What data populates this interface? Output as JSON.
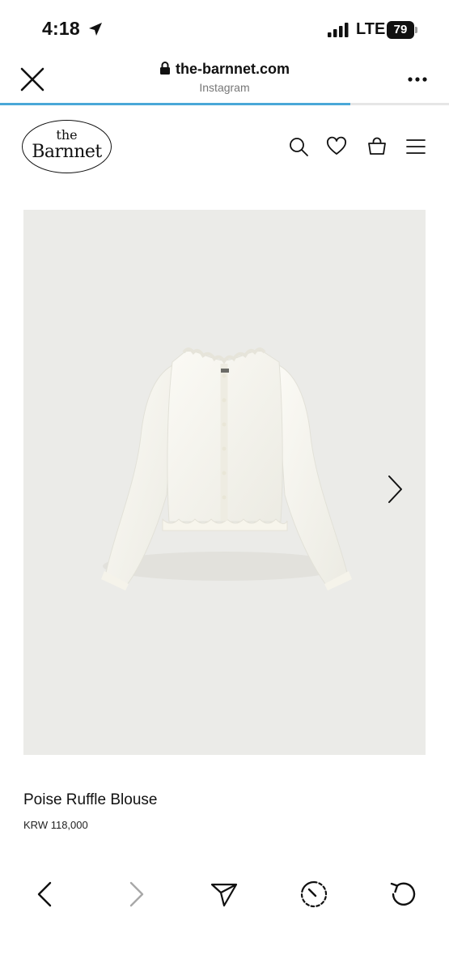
{
  "status_bar": {
    "time": "4:18",
    "network": "LTE",
    "battery": "79"
  },
  "browser": {
    "domain": "the-barnnet.com",
    "source": "Instagram",
    "load_progress_percent": 78,
    "progress_color": "#4aa8d8"
  },
  "site": {
    "logo_top": "the",
    "logo_name": "Barnnet",
    "header_icons": [
      "search-icon",
      "heart-icon",
      "bag-icon",
      "menu-icon"
    ]
  },
  "product": {
    "name": "Poise Ruffle Blouse",
    "price": "KRW 118,000",
    "image_background": "#ebebe8"
  },
  "toolbar": {
    "icons": [
      "back-icon",
      "forward-icon",
      "share-icon",
      "timer-icon",
      "reload-icon"
    ]
  }
}
